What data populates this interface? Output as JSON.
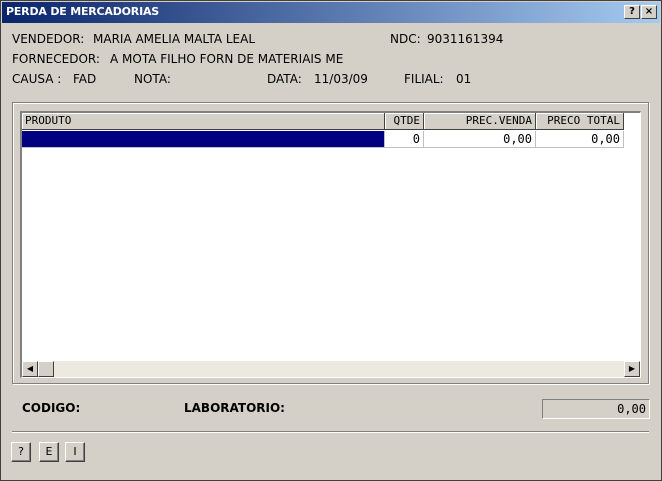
{
  "window": {
    "title": "PERDA DE MERCADORIAS",
    "help_button": "?",
    "close_button": "×"
  },
  "info": {
    "vendedor_label": "VENDEDOR:",
    "vendedor_value": "MARIA AMELIA MALTA LEAL",
    "ndc_label": "NDC:",
    "ndc_value": "9031161394",
    "fornecedor_label": "FORNECEDOR:",
    "fornecedor_value": "A MOTA FILHO FORN DE MATERIAIS ME",
    "causa_label": "CAUSA :",
    "causa_value": "FAD",
    "nota_label": "NOTA:",
    "nota_value": "",
    "data_label": "DATA:",
    "data_value": "11/03/09",
    "filial_label": "FILIAL:",
    "filial_value": "01"
  },
  "grid": {
    "columns": [
      "PRODUTO",
      "QTDE",
      "PREC.VENDA",
      "PRECO TOTAL"
    ],
    "rows": [
      {
        "produto": "",
        "qtde": "0",
        "prec_venda": "0,00",
        "preco_total": "0,00"
      }
    ]
  },
  "footer": {
    "codigo_label": "CODIGO:",
    "laboratorio_label": "LABORATORIO:",
    "total_value": "0,00"
  },
  "buttons": {
    "help": "?",
    "e": "E",
    "i": "I"
  },
  "colors": {
    "title_gradient_start": "#0a246a",
    "selected_row": "#000080",
    "window_bg": "#d4d0c8"
  }
}
